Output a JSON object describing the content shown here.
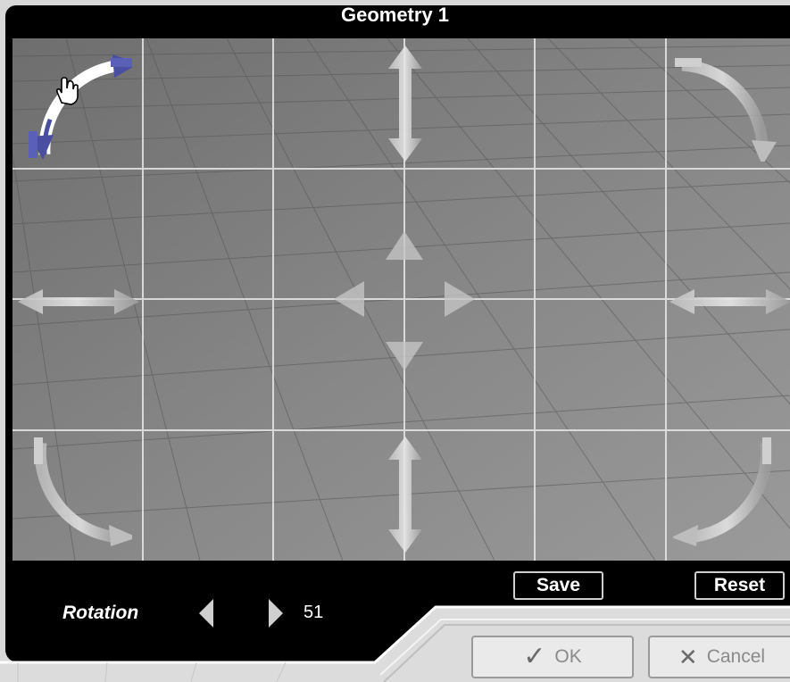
{
  "window": {
    "title": "Geometry 1"
  },
  "buttons": {
    "save": "Save",
    "reset": "Reset",
    "ok": "OK",
    "cancel": "Cancel"
  },
  "rotation": {
    "label": "Rotation",
    "value": "51"
  },
  "icons": {
    "rotate_top_left": "curved-arrow-icon",
    "rotate_top_right": "curved-arrow-icon",
    "rotate_bottom_left": "curved-arrow-icon",
    "rotate_bottom_right": "curved-arrow-icon",
    "move_vertical_top": "vertical-double-arrow-icon",
    "move_vertical_bottom": "vertical-double-arrow-icon",
    "move_horizontal_left": "horizontal-double-arrow-icon",
    "move_horizontal_right": "horizontal-double-arrow-icon",
    "center_pad": "four-way-arrow-icon",
    "cursor": "hand-cursor-icon",
    "ok": "checkmark-icon",
    "cancel": "x-icon"
  },
  "colors": {
    "active_handle": "#4a4ea0",
    "panel": "#000000",
    "viewport": "#7a7a7a"
  }
}
